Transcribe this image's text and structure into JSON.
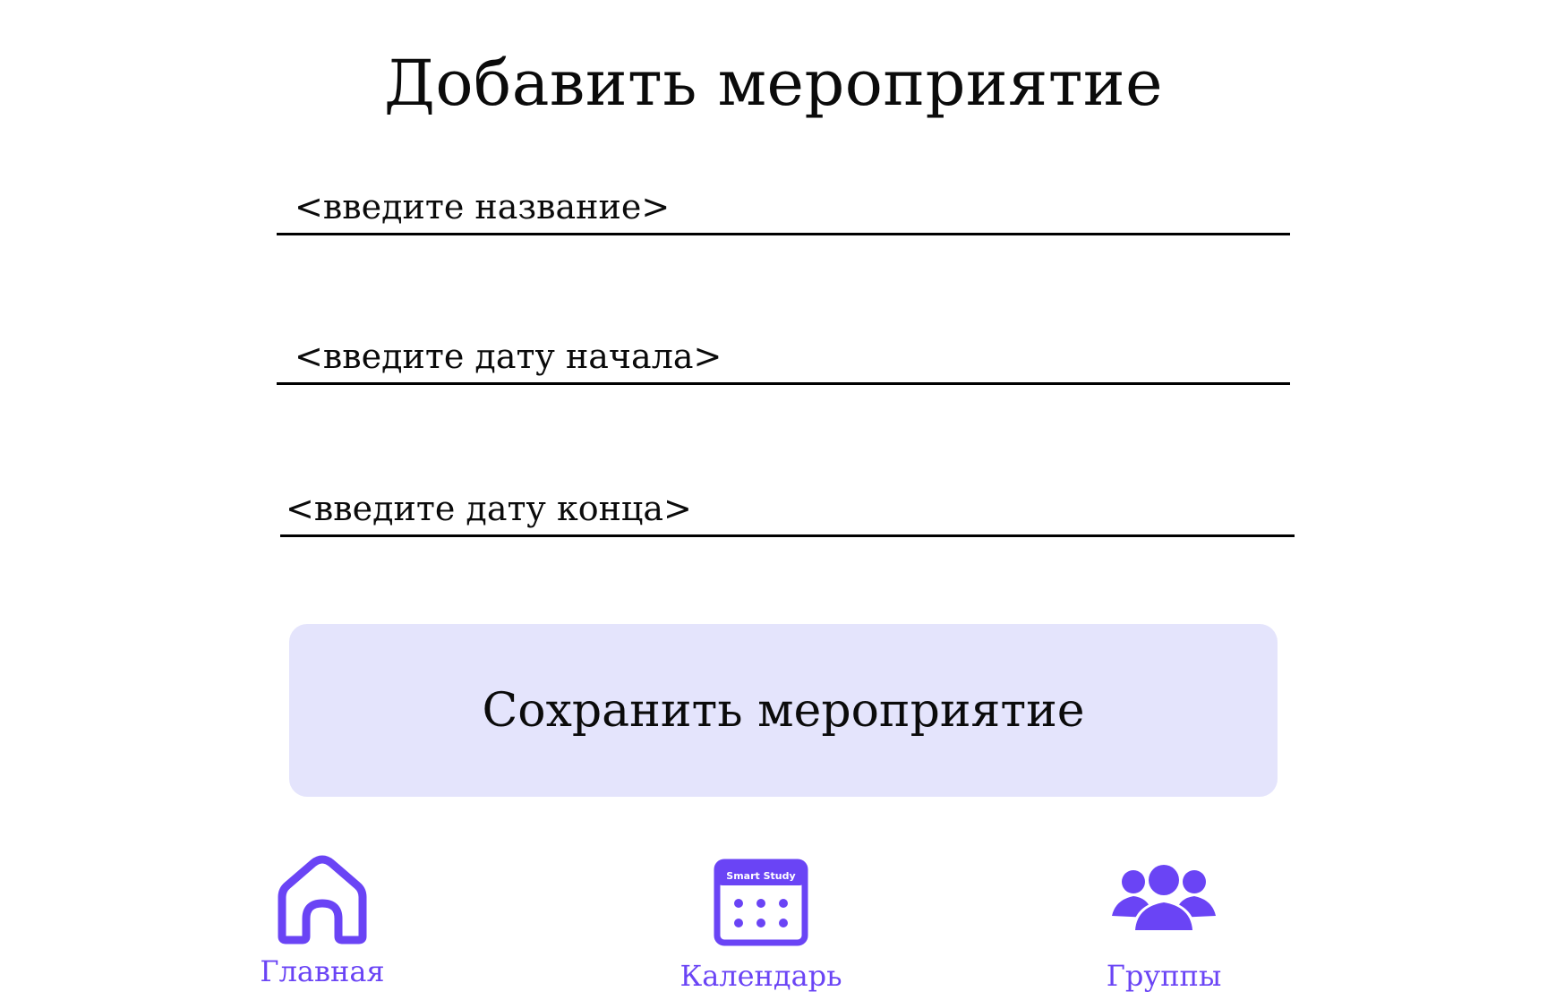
{
  "page": {
    "title": "Добавить мероприятие"
  },
  "form": {
    "name_placeholder": "<введите название>",
    "start_date_placeholder": "<введите дату начала>",
    "end_date_placeholder": "<введите дату конца>",
    "save_label": "Сохранить мероприятие"
  },
  "nav": {
    "home": {
      "label": "Главная",
      "icon": "home-icon"
    },
    "calendar": {
      "label": "Календарь",
      "icon": "calendar-icon",
      "icon_text": "Smart Study"
    },
    "groups": {
      "label": "Группы",
      "icon": "group-icon"
    }
  },
  "colors": {
    "accent": "#6a44f5",
    "button_bg": "#e4e4fc",
    "text": "#0b0b0b"
  }
}
